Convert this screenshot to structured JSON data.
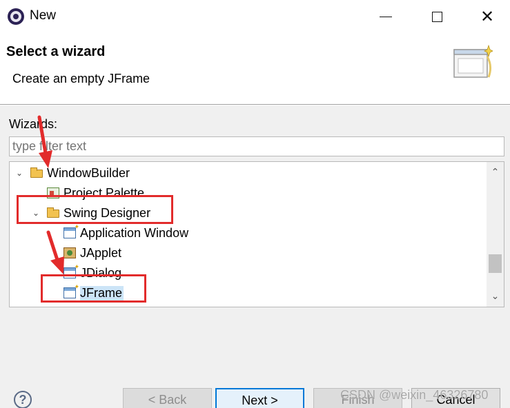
{
  "window": {
    "title": "New",
    "icon": "eclipse-icon",
    "controls": [
      "minimize-icon",
      "maximize-icon",
      "close-icon"
    ],
    "close_glyph": "✕"
  },
  "header": {
    "title": "Select a wizard",
    "description": "Create an empty JFrame",
    "icon": "wizard-banner-icon"
  },
  "wizards": {
    "label": "Wizards:",
    "filter_placeholder": "type filter text",
    "tree": [
      {
        "label": "WindowBuilder",
        "icon": "folder-open-icon",
        "expanded": true
      },
      {
        "label": "Project Palette",
        "icon": "palette-icon"
      },
      {
        "label": "Swing Designer",
        "icon": "folder-open-icon",
        "expanded": true
      },
      {
        "label": "Application Window",
        "icon": "frame-wizard-icon"
      },
      {
        "label": "JApplet",
        "icon": "applet-icon"
      },
      {
        "label": "JDialog",
        "icon": "frame-wizard-icon"
      },
      {
        "label": "JFrame",
        "icon": "frame-wizard-icon",
        "selected": true
      }
    ],
    "expand_glyph": "⌄",
    "scroll_up_glyph": "⌃",
    "scroll_down_glyph": "⌄"
  },
  "footer": {
    "help_glyph": "?",
    "back_label": "< Back",
    "next_label": "Next >",
    "finish_label": "Finish",
    "cancel_label": "Cancel",
    "watermark": "CSDN @weixin_46326780"
  },
  "colors": {
    "annotation_red": "#e22b2b",
    "selection": "#cce4f7",
    "default_button_border": "#0078d7"
  }
}
